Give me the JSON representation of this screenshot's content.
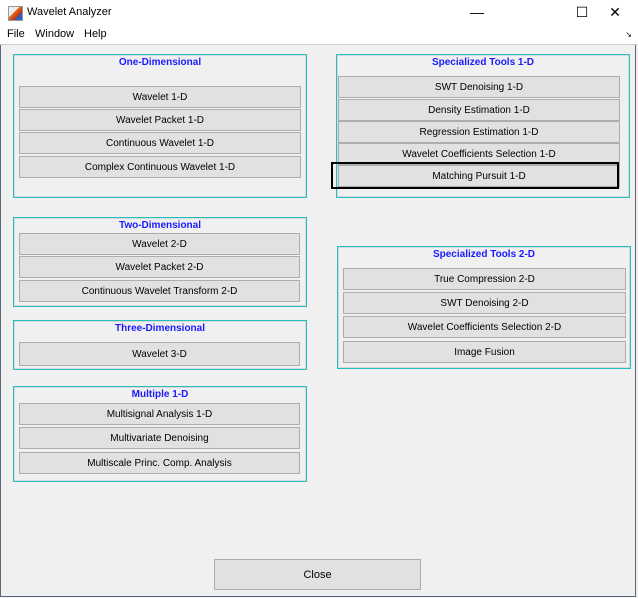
{
  "window": {
    "title": "Wavelet Analyzer",
    "minimize": "—",
    "maximize": "☐",
    "close": "✕",
    "dock": "↘"
  },
  "menu": [
    "File",
    "Window",
    "Help"
  ],
  "panels": [
    {
      "title": "One-Dimensional",
      "buttons": [
        "Wavelet 1-D",
        "Wavelet Packet 1-D",
        "Continuous Wavelet 1-D",
        "Complex Continuous Wavelet 1-D"
      ]
    },
    {
      "title": "Two-Dimensional",
      "buttons": [
        "Wavelet 2-D",
        "Wavelet Packet 2-D",
        "Continuous Wavelet Transform 2-D"
      ]
    },
    {
      "title": "Three-Dimensional",
      "buttons": [
        "Wavelet 3-D"
      ]
    },
    {
      "title": "Multiple 1-D",
      "buttons": [
        "Multisignal Analysis 1-D",
        "Multivariate Denoising",
        "Multiscale Princ. Comp. Analysis"
      ]
    },
    {
      "title": "Specialized Tools 1-D",
      "buttons": [
        "SWT Denoising 1-D",
        "Density Estimation 1-D",
        "Regression Estimation 1-D",
        "Wavelet Coefficients Selection 1-D",
        "Matching Pursuit 1-D"
      ]
    },
    {
      "title": "Specialized Tools 2-D",
      "buttons": [
        "True Compression 2-D",
        "SWT Denoising 2-D",
        "Wavelet Coefficients Selection 2-D",
        "Image Fusion"
      ]
    }
  ],
  "focused_button": "Matching Pursuit 1-D",
  "close_button": "Close"
}
